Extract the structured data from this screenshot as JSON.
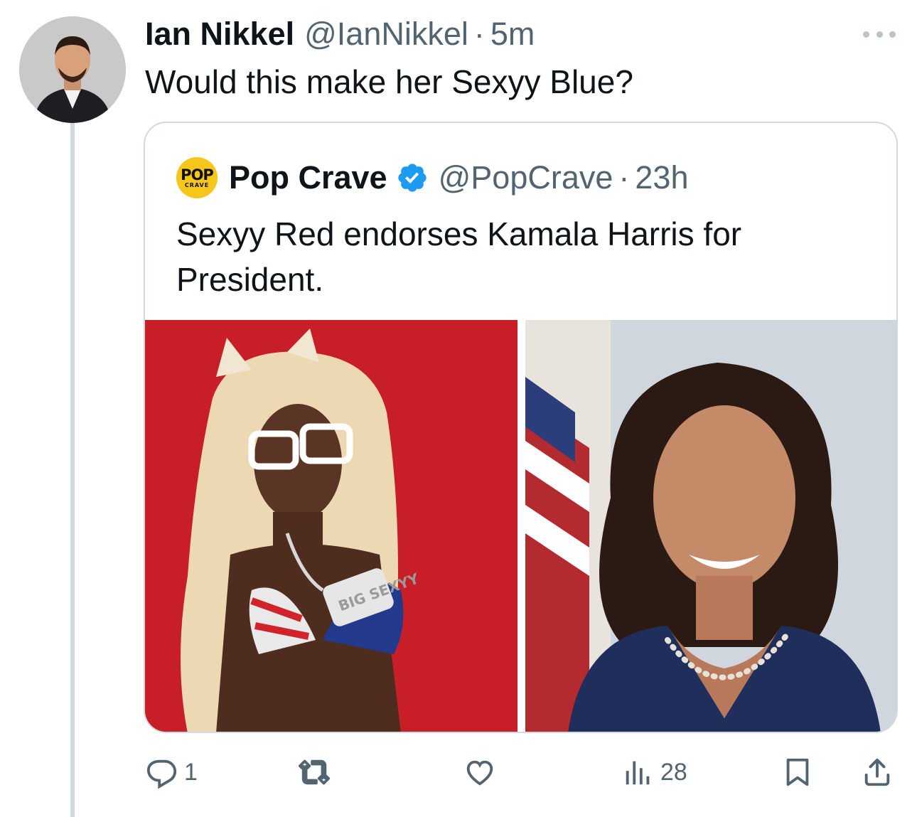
{
  "tweet": {
    "author_name": "Ian Nikkel",
    "author_handle": "@IanNikkel",
    "separator": "·",
    "time": "5m",
    "text": "Would this make her Sexyy Blue?"
  },
  "quoted_tweet": {
    "logo_text_top": "POP",
    "logo_text_bottom": "CRAVE",
    "author_name": "Pop Crave",
    "verified": true,
    "author_handle": "@PopCrave",
    "separator": "·",
    "time": "23h",
    "text": "Sexyy Red endorses Kamala Harris for President.",
    "media": [
      {
        "description_icon": "photo-icon",
        "background": "#c51b23"
      },
      {
        "description_icon": "photo-icon",
        "background": "#cfd6de"
      }
    ],
    "image_overlay_text": "BIG SEXYY"
  },
  "actions": {
    "reply_count": "1",
    "retweet_count": "",
    "like_count": "",
    "views_count": "28"
  },
  "colors": {
    "text_primary": "#0f1419",
    "text_secondary": "#536471",
    "border": "#cfd9de",
    "verified_blue": "#1d9bf0"
  }
}
